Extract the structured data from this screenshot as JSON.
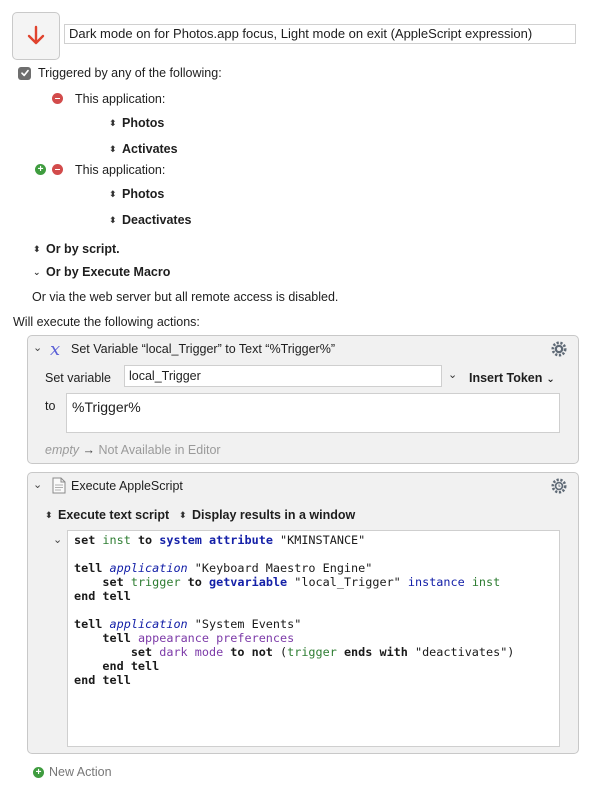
{
  "macro": {
    "name": "Dark mode on for Photos.app focus, Light mode on exit (AppleScript expression)",
    "icon": "down-arrow-icon",
    "icon_color": "#e0432e"
  },
  "triggers": {
    "header": "Triggered by any of the following:",
    "items": [
      {
        "label": "This application:",
        "app": "Photos",
        "event": "Activates"
      },
      {
        "label": "This application:",
        "app": "Photos",
        "event": "Deactivates"
      }
    ],
    "or_script": "Or by script.",
    "or_execute_macro": "Or by Execute Macro",
    "web_server": "Or via the web server but all remote access is disabled."
  },
  "actions": {
    "header": "Will execute the following actions:",
    "set_variable": {
      "title": "Set Variable “local_Trigger” to Text “%Trigger%”",
      "set_variable_label": "Set variable",
      "variable_name": "local_Trigger",
      "insert_token": "Insert Token",
      "to_label": "to",
      "text_value": "%Trigger%",
      "empty_label": "empty",
      "arrow": "→",
      "preview": "Not Available in Editor"
    },
    "applescript": {
      "title": "Execute AppleScript",
      "mode": "Execute text script",
      "output": "Display results in a window"
    },
    "new_action": "New Action"
  },
  "colors": {
    "accent_red": "#d24b4b",
    "accent_green": "#3f9c3f",
    "keyword_blue": "#1420a8",
    "variable_green": "#2e7d32",
    "property_purple": "#7c3aa8"
  }
}
